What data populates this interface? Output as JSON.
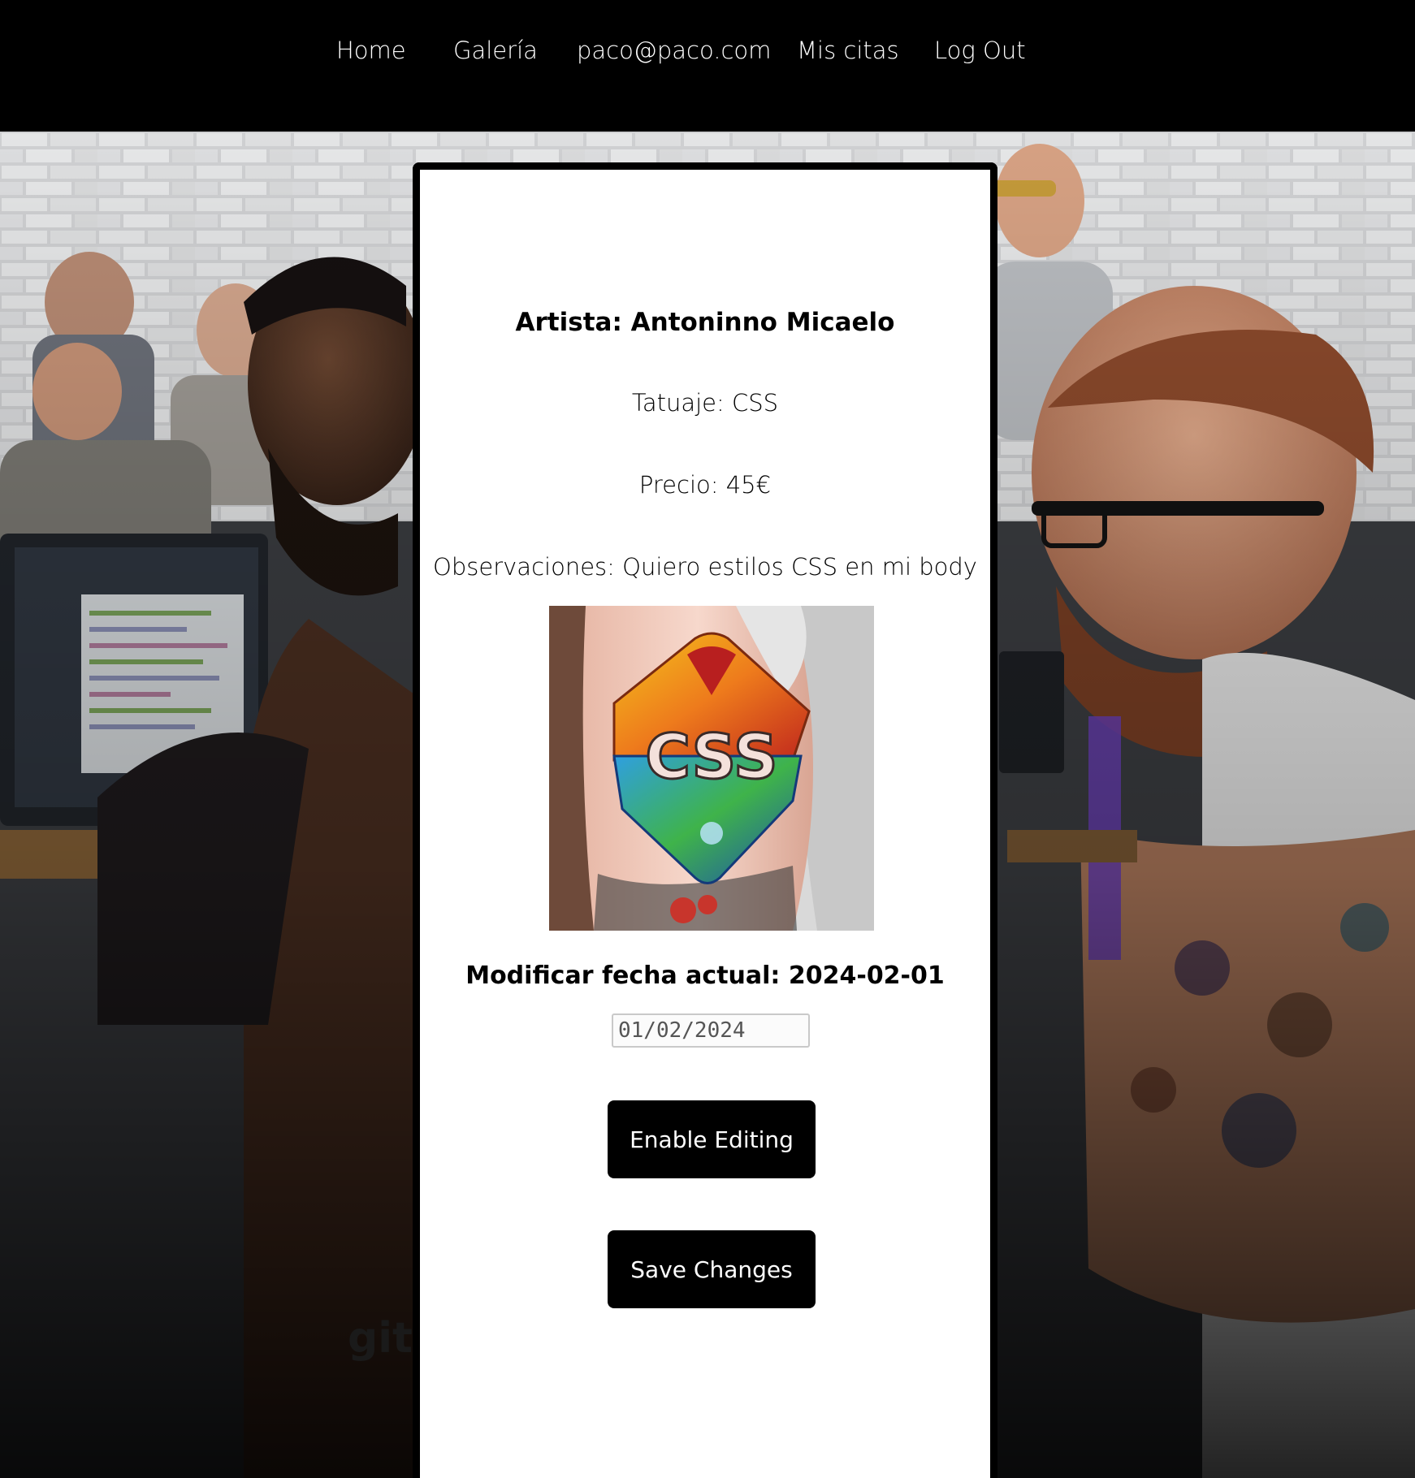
{
  "nav": {
    "items": [
      {
        "label": "Home"
      },
      {
        "label": "Galería"
      },
      {
        "label": "paco@paco.com"
      },
      {
        "label": "Mis citas"
      },
      {
        "label": "Log Out"
      }
    ]
  },
  "background": {
    "watermark_text": "git"
  },
  "appointment": {
    "artist": "Artista: Antoninno Micaelo",
    "tattoo": "Tatuaje: CSS",
    "price": "Precio: 45€",
    "observations": "Observaciones: Quiero estilos CSS en mi body",
    "tattoo_image_text": "CSS",
    "date_heading": "Modificar fecha actual: 2024-02-01",
    "date_value": "01/02/2024",
    "enable_label": "Enable Editing",
    "save_label": "Save Changes"
  }
}
